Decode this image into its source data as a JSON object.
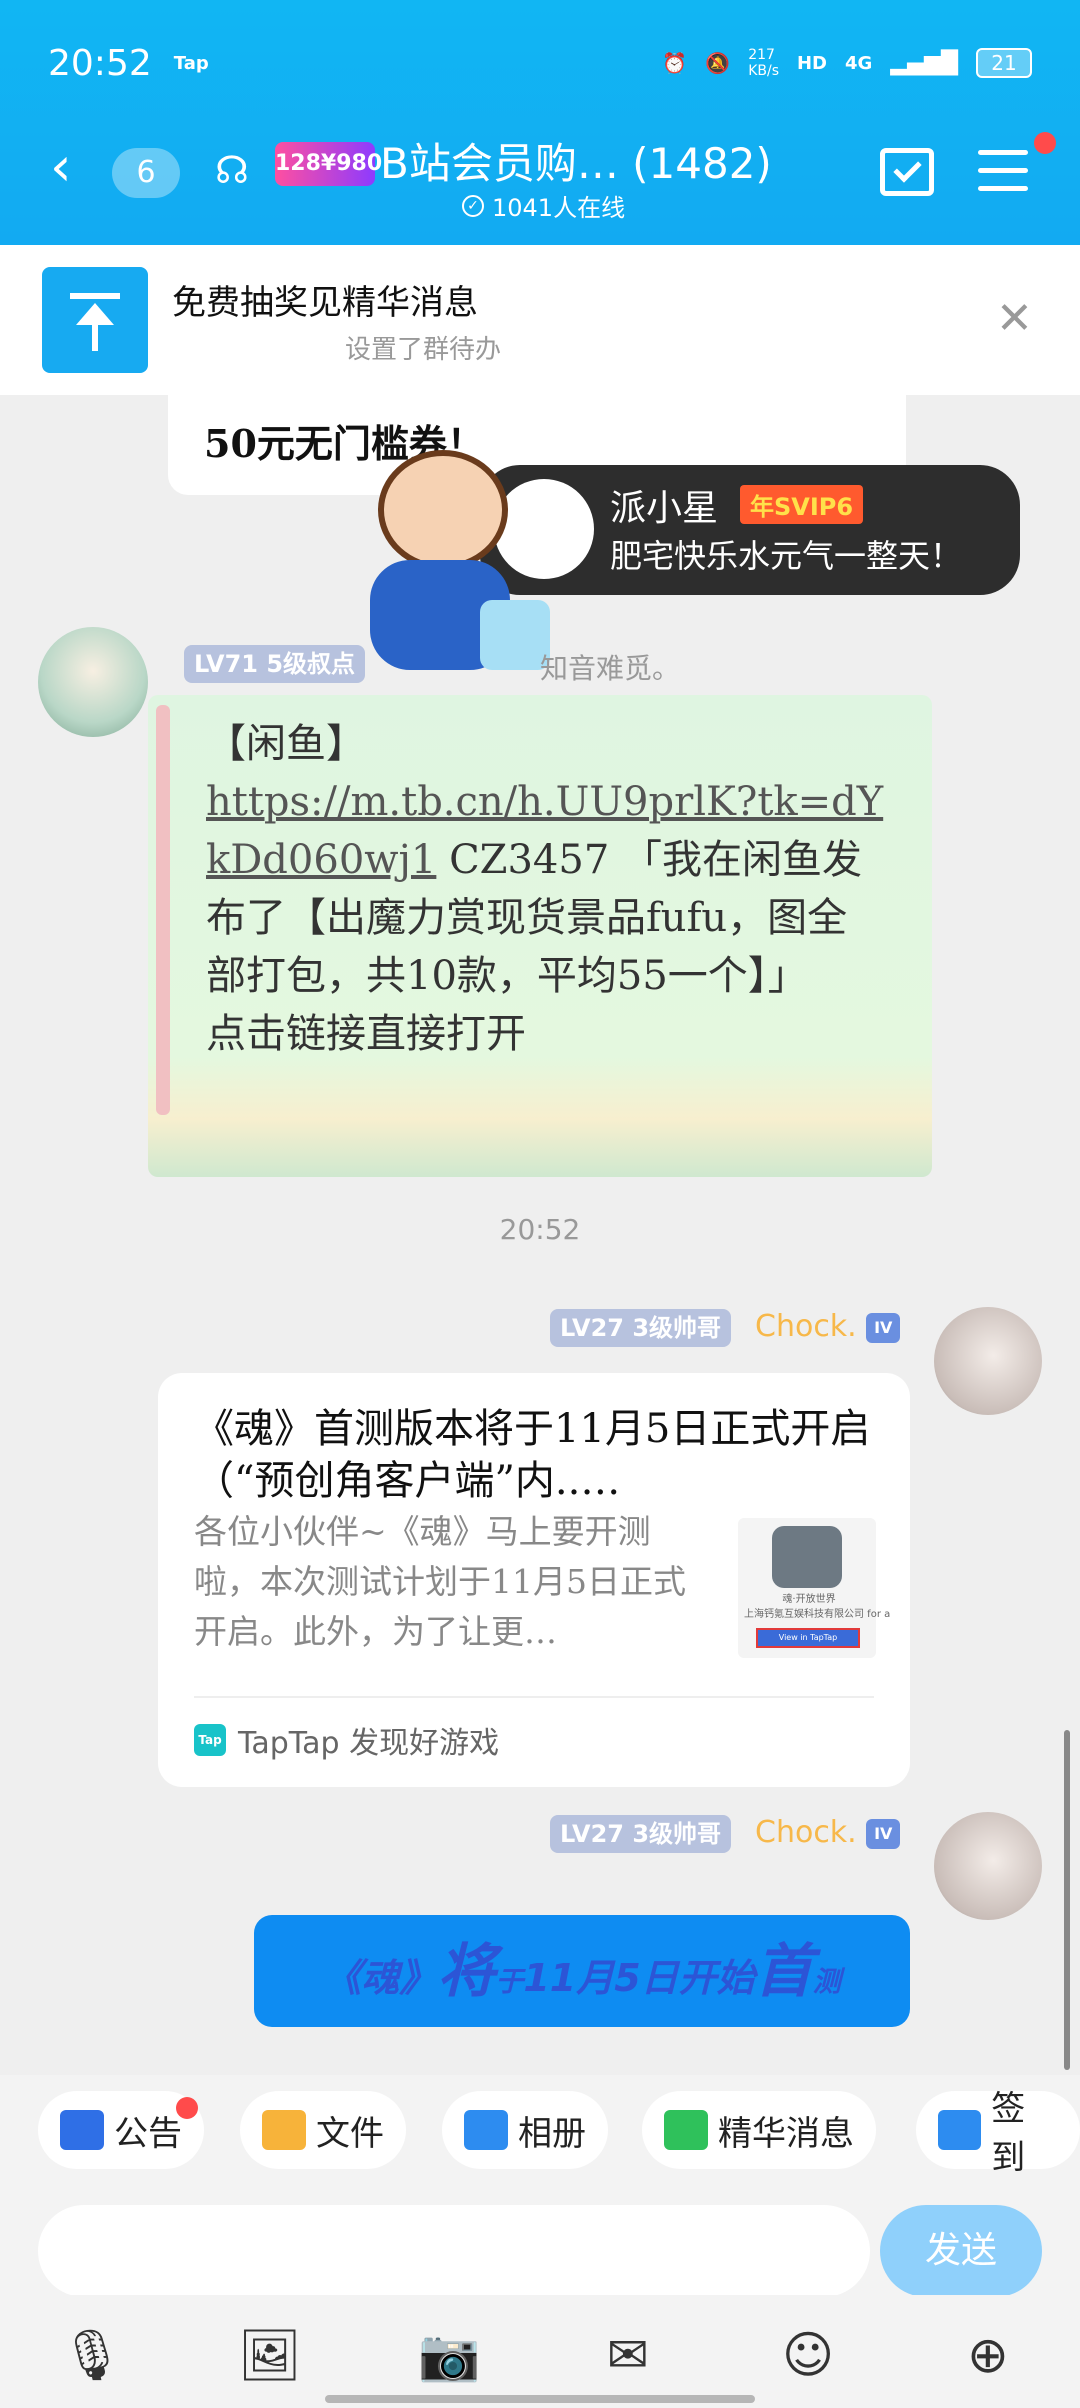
{
  "status_bar": {
    "time": "20:52",
    "tap_label": "Tap",
    "net_speed": "217\nKB/s",
    "hd": "HD",
    "network": "4G",
    "battery": "21"
  },
  "header": {
    "back_count": "6",
    "group_logo": "128¥980",
    "group_title": "B站会员购… (1482)",
    "online": "1041人在线"
  },
  "pinned": {
    "title": "免费抽奖见精华消息",
    "subtitle": "设置了群待办"
  },
  "messages": {
    "top_bubble_text": "50元无门槛券！",
    "vip_card": {
      "name": "派小星",
      "badge": "年SVIP6",
      "signature": "肥宅快乐水元气一整天！"
    },
    "msg1": {
      "level": "LV71 5级叔点",
      "sender_suffix": "知音难觅。",
      "line_title": "【闲鱼】",
      "link": "https://m.tb.cn/h.UU9prlK?tk=dYkDd060wj1",
      "body": " CZ3457 「我在闲鱼发布了【出魔力赏现货景品fufu，图全部打包，共10款，平均55一个】」",
      "footer": "点击链接直接打开"
    },
    "timestamp": "20:52",
    "msg2": {
      "level": "LV27 3级帅哥",
      "sender": "Chock.",
      "title": "《魂》首测版本将于11月5日正式开启（“预创角客户端”内..…",
      "desc": "各位小伙伴~《魂》马上要开测啦，本次测试计划于11月5日正式开启。此外，为了让更…",
      "thumb_caption": "魂·开放世界\n上海钙氪互娱科技有限公司 for a",
      "thumb_button": "View in TapTap",
      "source": "TapTap 发现好游戏"
    },
    "msg3": {
      "level": "LV27 3级帅哥",
      "sender": "Chock.",
      "text_1": "《魂》",
      "text_2": "将",
      "text_3": "于",
      "text_4": "11月5日开始",
      "text_5": "首",
      "text_6": "测"
    }
  },
  "toolbar": {
    "items": [
      {
        "label": "公告",
        "color": "#2f6fe6"
      },
      {
        "label": "文件",
        "color": "#f7b33a"
      },
      {
        "label": "相册",
        "color": "#2d8cf0"
      },
      {
        "label": "精华消息",
        "color": "#2fc15b"
      },
      {
        "label": "签到",
        "color": "#2d8cf0"
      }
    ]
  },
  "input": {
    "placeholder": "",
    "send_label": "发送"
  },
  "bottom_icons": [
    "microphone-icon",
    "image-icon",
    "camera-icon",
    "red-packet-icon",
    "emoji-icon",
    "plus-icon"
  ]
}
